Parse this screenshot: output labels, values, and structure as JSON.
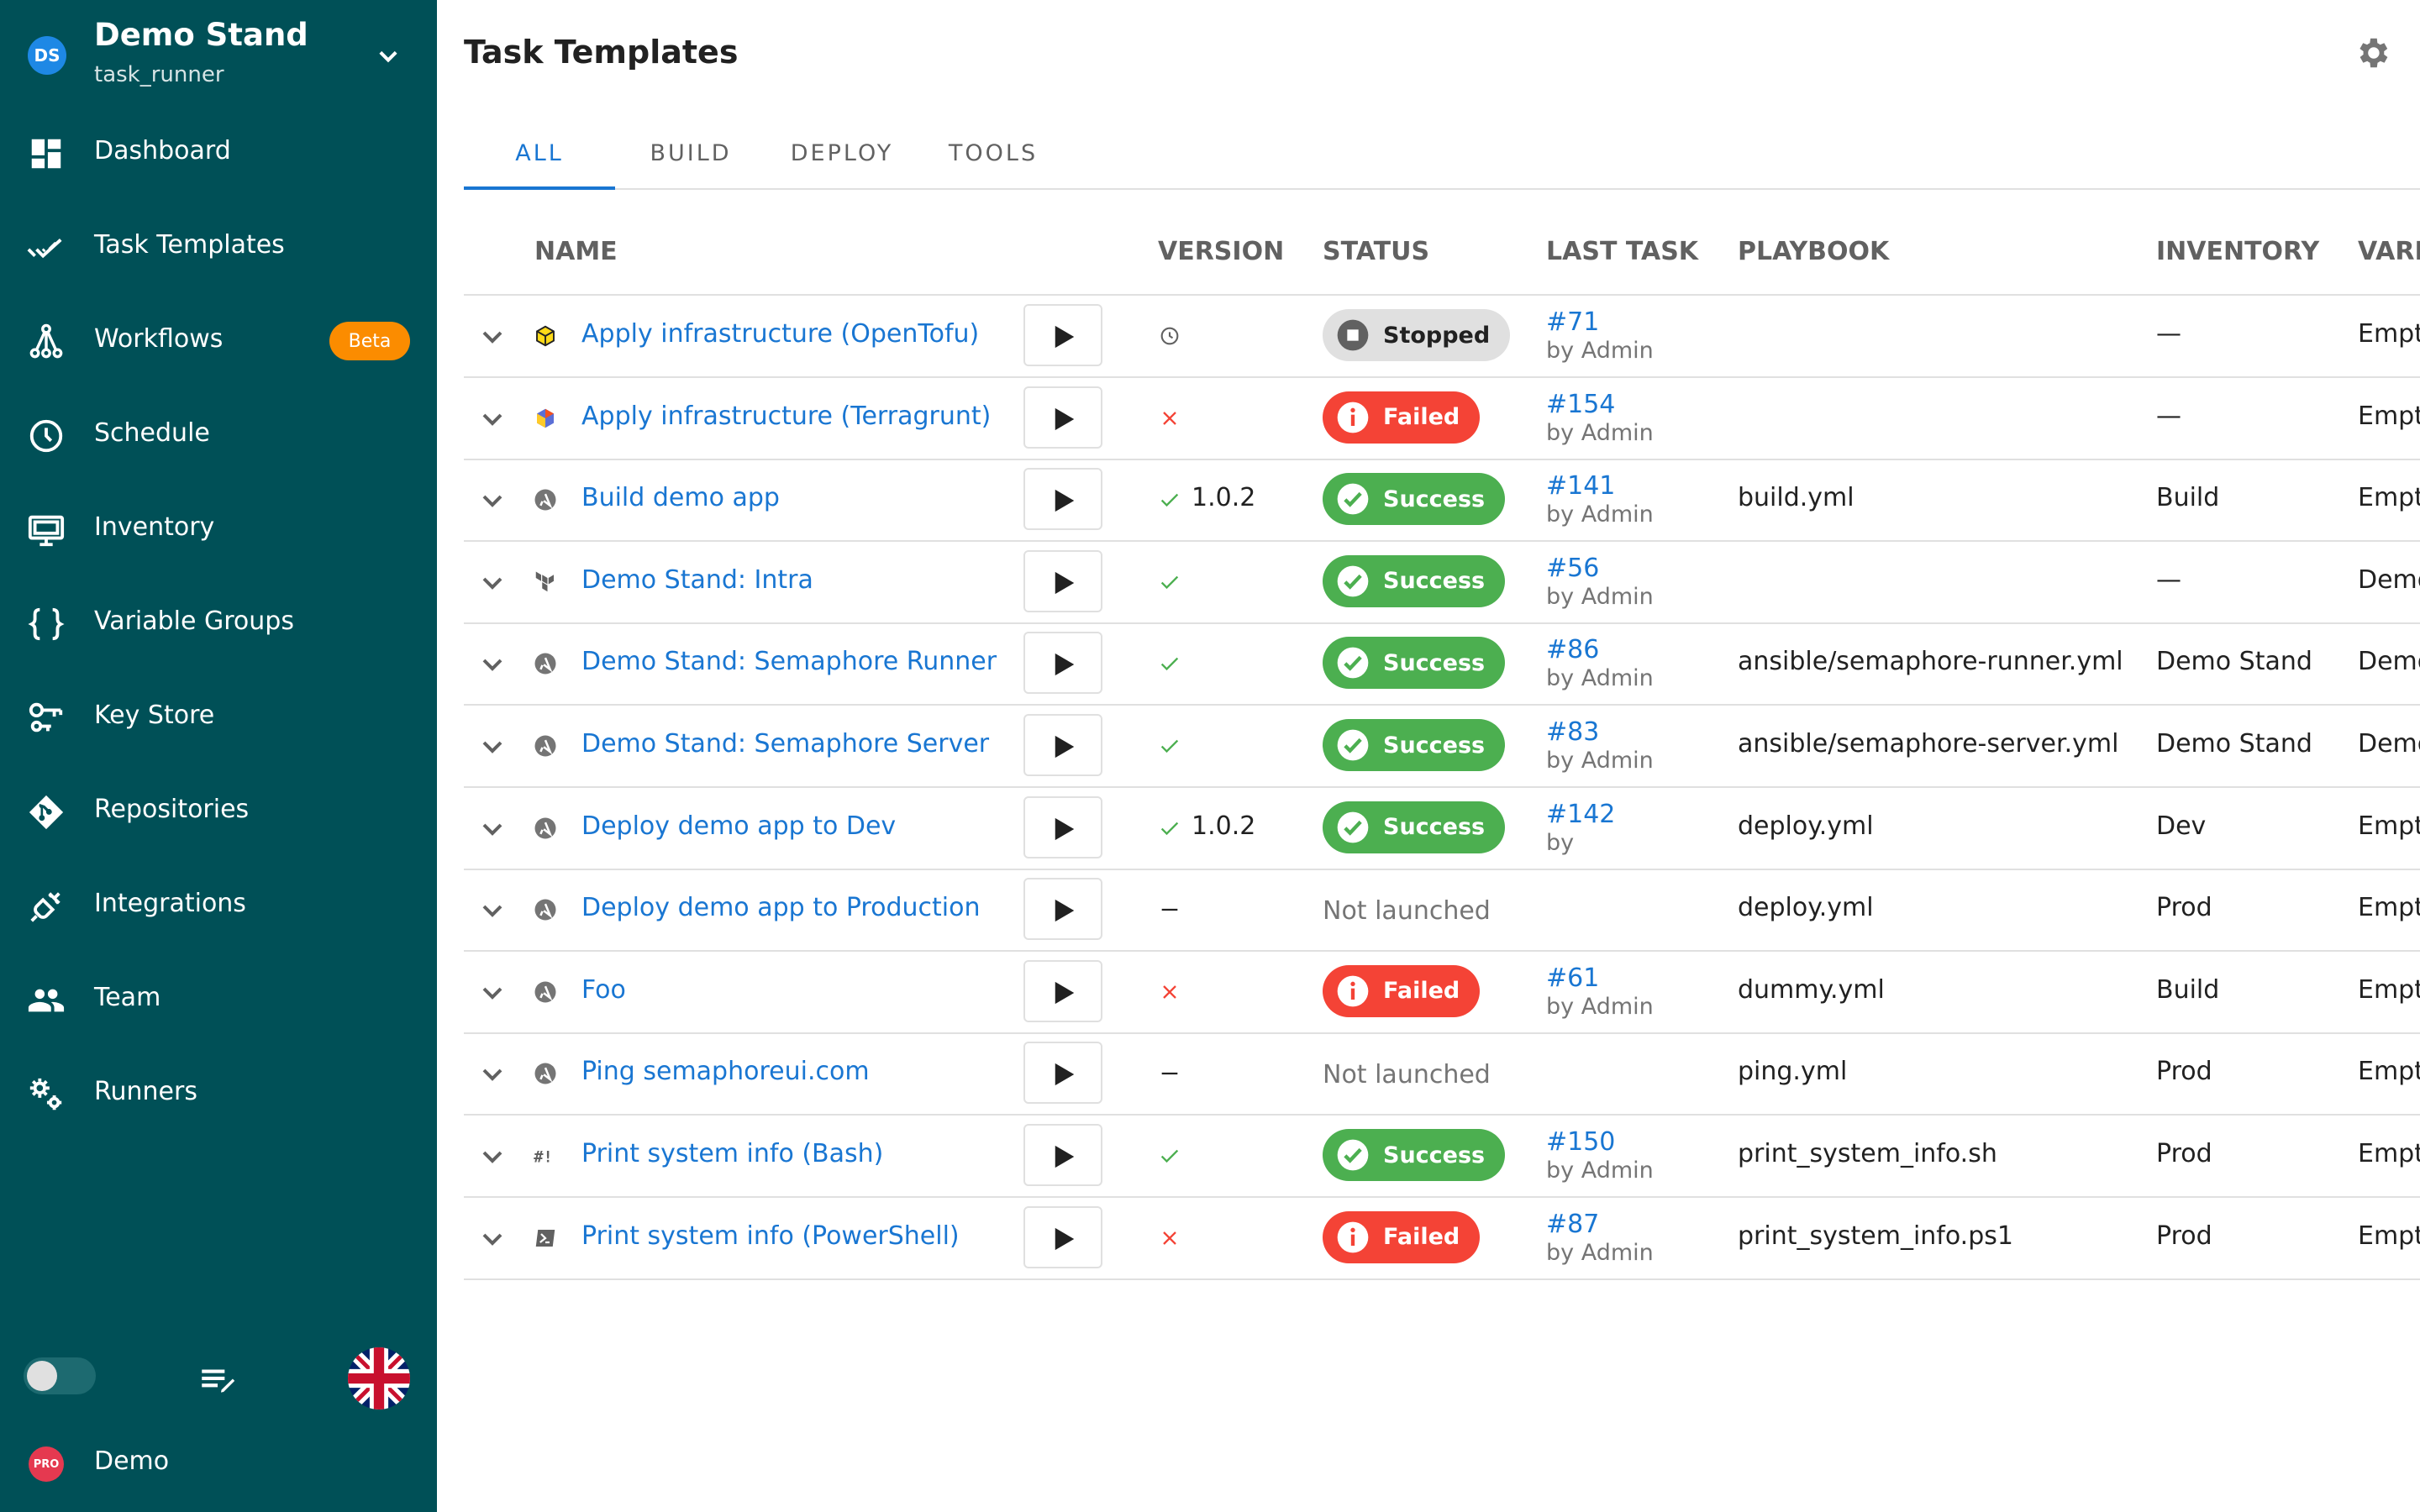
{
  "project": {
    "initials": "DS",
    "name": "Demo Stand",
    "subtitle": "task_runner"
  },
  "nav": [
    {
      "key": "dashboard",
      "label": "Dashboard",
      "icon": "dashboard-icon"
    },
    {
      "key": "task-templates",
      "label": "Task Templates",
      "icon": "double-check-icon"
    },
    {
      "key": "workflows",
      "label": "Workflows",
      "icon": "workflow-icon",
      "badge": "Beta"
    },
    {
      "key": "schedule",
      "label": "Schedule",
      "icon": "clock-icon"
    },
    {
      "key": "inventory",
      "label": "Inventory",
      "icon": "monitor-icon"
    },
    {
      "key": "variable-groups",
      "label": "Variable Groups",
      "icon": "braces-icon"
    },
    {
      "key": "key-store",
      "label": "Key Store",
      "icon": "key-icon"
    },
    {
      "key": "repositories",
      "label": "Repositories",
      "icon": "git-icon"
    },
    {
      "key": "integrations",
      "label": "Integrations",
      "icon": "plug-icon"
    },
    {
      "key": "team",
      "label": "Team",
      "icon": "people-icon"
    },
    {
      "key": "runners",
      "label": "Runners",
      "icon": "gears-icon"
    }
  ],
  "footer": {
    "pro_badge": "PRO",
    "pro_label": "Demo",
    "language_icon": "uk-flag-icon",
    "theme_toggle_icon": "theme-toggle-icon",
    "edit_icon": "playlist-edit-icon"
  },
  "page": {
    "title": "Task Templates",
    "settings_icon": "gear-icon"
  },
  "tabs": [
    "ALL",
    "BUILD",
    "DEPLOY",
    "TOOLS"
  ],
  "active_tab": "ALL",
  "columns": {
    "name": "NAME",
    "version": "VERSION",
    "status": "STATUS",
    "last_task": "LAST TASK",
    "playbook": "PLAYBOOK",
    "inventory": "INVENTORY",
    "variables": "VARI..."
  },
  "templates": [
    {
      "icon": "opentofu-icon",
      "name": "Apply infrastructure (OpenTofu)",
      "ver_icon": "clock",
      "version": "",
      "status": "Stopped",
      "last_id": "#71",
      "last_by": "by Admin",
      "playbook": "",
      "inventory": "—",
      "variables": "Empt"
    },
    {
      "icon": "terragrunt-icon",
      "name": "Apply infrastructure (Terragrunt)",
      "ver_icon": "cross",
      "version": "",
      "status": "Failed",
      "last_id": "#154",
      "last_by": "by Admin",
      "playbook": "",
      "inventory": "—",
      "variables": "Empt"
    },
    {
      "icon": "ansible-icon",
      "name": "Build demo app",
      "ver_icon": "check",
      "version": "1.0.2",
      "status": "Success",
      "last_id": "#141",
      "last_by": "by Admin",
      "playbook": "build.yml",
      "inventory": "Build",
      "variables": "Empt"
    },
    {
      "icon": "terraform-icon",
      "name": "Demo Stand: Intra",
      "ver_icon": "check",
      "version": "",
      "status": "Success",
      "last_id": "#56",
      "last_by": "by Admin",
      "playbook": "",
      "inventory": "—",
      "variables": "Demo"
    },
    {
      "icon": "ansible-icon",
      "name": "Demo Stand: Semaphore Runner",
      "ver_icon": "check",
      "version": "",
      "status": "Success",
      "last_id": "#86",
      "last_by": "by Admin",
      "playbook": "ansible/semaphore-runner.yml",
      "inventory": "Demo Stand",
      "variables": "Demo"
    },
    {
      "icon": "ansible-icon",
      "name": "Demo Stand: Semaphore Server",
      "ver_icon": "check",
      "version": "",
      "status": "Success",
      "last_id": "#83",
      "last_by": "by Admin",
      "playbook": "ansible/semaphore-server.yml",
      "inventory": "Demo Stand",
      "variables": "Demo"
    },
    {
      "icon": "ansible-icon",
      "name": "Deploy demo app to Dev",
      "ver_icon": "check",
      "version": "1.0.2",
      "status": "Success",
      "last_id": "#142",
      "last_by": "by",
      "playbook": "deploy.yml",
      "inventory": "Dev",
      "variables": "Empt"
    },
    {
      "icon": "ansible-icon",
      "name": "Deploy demo app to Production",
      "ver_icon": "dash",
      "version": "",
      "status": "Not launched",
      "last_id": "",
      "last_by": "",
      "playbook": "deploy.yml",
      "inventory": "Prod",
      "variables": "Empt"
    },
    {
      "icon": "ansible-icon",
      "name": "Foo",
      "ver_icon": "cross",
      "version": "",
      "status": "Failed",
      "last_id": "#61",
      "last_by": "by Admin",
      "playbook": "dummy.yml",
      "inventory": "Build",
      "variables": "Empt"
    },
    {
      "icon": "ansible-icon",
      "name": "Ping semaphoreui.com",
      "ver_icon": "dash",
      "version": "",
      "status": "Not launched",
      "last_id": "",
      "last_by": "",
      "playbook": "ping.yml",
      "inventory": "Prod",
      "variables": "Empt"
    },
    {
      "icon": "bash-icon",
      "name": "Print system info (Bash)",
      "ver_icon": "check",
      "version": "",
      "status": "Success",
      "last_id": "#150",
      "last_by": "by Admin",
      "playbook": "print_system_info.sh",
      "inventory": "Prod",
      "variables": "Empt"
    },
    {
      "icon": "powershell-icon",
      "name": "Print system info (PowerShell)",
      "ver_icon": "cross",
      "version": "",
      "status": "Failed",
      "last_id": "#87",
      "last_by": "by Admin",
      "playbook": "print_system_info.ps1",
      "inventory": "Prod",
      "variables": "Empt"
    }
  ],
  "colors": {
    "sidebar": "#005057",
    "accent": "#1976d2",
    "success": "#4caf50",
    "failed": "#f44336",
    "beta": "#fb8c00"
  }
}
